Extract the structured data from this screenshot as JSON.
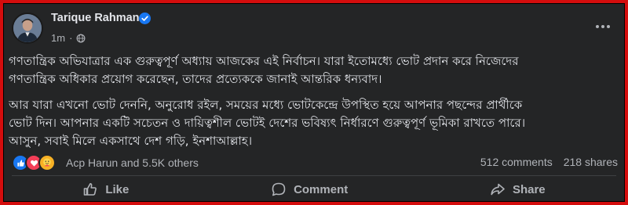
{
  "post": {
    "author": "Tarique Rahman",
    "time": "1m",
    "separator": "·",
    "paragraph1": [
      "গণতান্ত্রিক অভিযাত্রার এক গুরুত্বপূর্ণ অধ্যায় আজকের এই নির্বাচন। যারা ইতোমধ্যে ভোট প্রদান করে নিজেদের",
      "গণতান্ত্রিক অধিকার প্রয়োগ করেছেন, তাদের প্রত্যেককে জানাই আন্তরিক ধন্যবাদ।"
    ],
    "paragraph2": [
      "আর যারা এখনো ভোট দেননি, অনুরোধ রইল, সময়ের মধ্যে ভোটকেন্দ্রে উপস্থিত হয়ে আপনার পছন্দের প্রার্থীকে",
      "ভোট দিন। আপনার একটি সচেতন ও দায়িত্বশীল ভোটই দেশের ভবিষ্যৎ নির্ধারণে গুরুত্বপূর্ণ ভূমিকা রাখতে পারে।",
      "আসুন, সবাই মিলে একসাথে দেশ গড়ি, ইনশাআল্লাহ।"
    ]
  },
  "reactions": {
    "icons": [
      "like-icon",
      "love-icon",
      "care-icon"
    ],
    "summary": "Acp Harun and 5.5K others",
    "comments": "512 comments",
    "shares": "218 shares"
  },
  "actions": {
    "like": "Like",
    "comment": "Comment",
    "share": "Share"
  },
  "colors": {
    "background": "#242526",
    "outer_border": "#d40d0d",
    "text": "#e4e6eb",
    "muted": "#b0b3b8",
    "verified": "#1877f2",
    "like": "#1877f2",
    "love": "#f33e58",
    "care": "#f7b125"
  }
}
